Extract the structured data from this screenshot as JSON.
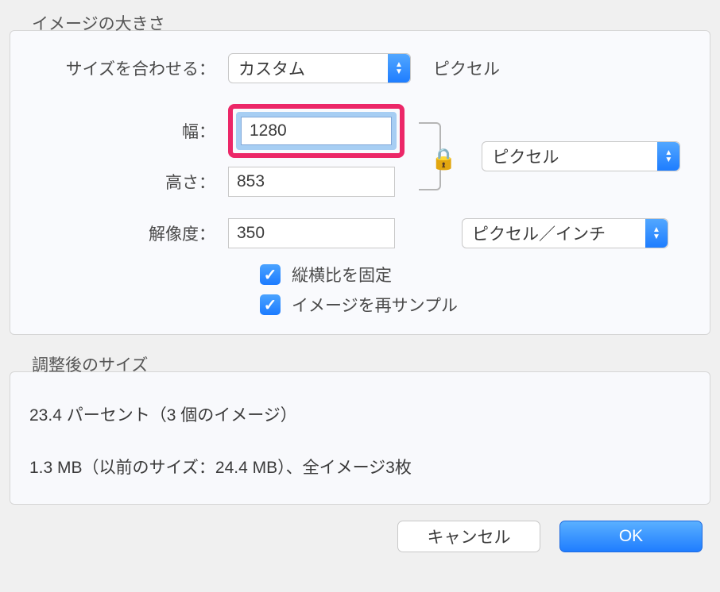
{
  "topSection": {
    "title": "イメージの大きさ",
    "fitLabel": "サイズを合わせる：",
    "fitValue": "カスタム",
    "fitUnitAfter": "ピクセル",
    "widthLabel": "幅：",
    "widthValue": "1280",
    "heightLabel": "高さ：",
    "heightValue": "853",
    "dimensionUnit": "ピクセル",
    "resolutionLabel": "解像度：",
    "resolutionValue": "350",
    "resolutionUnit": "ピクセル／インチ",
    "lockAspectLabel": "縦横比を固定",
    "resampleLabel": "イメージを再サンプル"
  },
  "resultSection": {
    "title": "調整後のサイズ",
    "line1": "23.4 パーセント（3 個のイメージ）",
    "line2": "1.3 MB（以前のサイズ：24.4 MB）、全イメージ3枚"
  },
  "buttons": {
    "cancel": "キャンセル",
    "ok": "OK"
  }
}
